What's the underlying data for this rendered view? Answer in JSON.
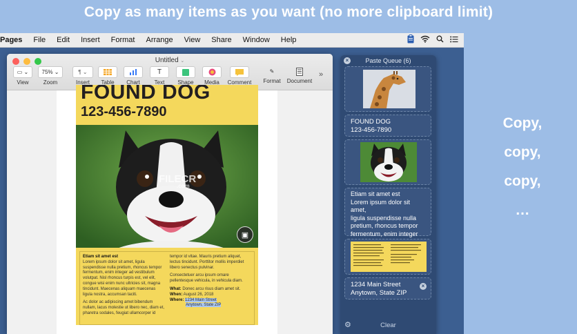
{
  "headline": "Copy as many items as you want (no more clipboard limit)",
  "menubar": {
    "app": "Pages",
    "items": [
      "File",
      "Edit",
      "Insert",
      "Format",
      "Arrange",
      "View",
      "Share",
      "Window",
      "Help"
    ],
    "status_icons": [
      "clipboard-icon",
      "wifi-icon",
      "search-icon",
      "list-icon"
    ]
  },
  "window": {
    "title": "Untitled",
    "zoom_value": "75%",
    "toolbar": [
      {
        "label": "View",
        "icon": "view-icon"
      },
      {
        "label": "Zoom",
        "icon": "zoom-select"
      },
      {
        "label": "Insert",
        "icon": "paragraph-icon"
      },
      {
        "label": "Table",
        "icon": "table-icon"
      },
      {
        "label": "Chart",
        "icon": "chart-icon"
      },
      {
        "label": "Text",
        "icon": "text-icon"
      },
      {
        "label": "Shape",
        "icon": "shape-icon"
      },
      {
        "label": "Media",
        "icon": "media-icon"
      },
      {
        "label": "Comment",
        "icon": "comment-icon"
      },
      {
        "label": "Format",
        "icon": "format-icon"
      },
      {
        "label": "Document",
        "icon": "document-icon"
      }
    ],
    "overflow": "»"
  },
  "flyer": {
    "title": "FOUND DOG",
    "phone": "123-456-7890",
    "col1_heading": "Etiam sit amet est",
    "col1_para1": "Lorem ipsum dolor sit amet, ligula suspendisse nulla pretium, rhoncus tempor fermentum, enim integer ad vestibulum volutpat. Nisl rhoncus turpis est, vel elit, congue wisi enim nunc ultricies sit, magna tincidunt. Maecenas aliquam maecenas ligula nostra, accumsan taciti.",
    "col1_para2": "Ac dolor ac adipiscing amet bibendum nullam, lacus molestie ut libero nec, diam et, pharetra sodales, feugiat ullamcorper id",
    "col2_para1": "tempor id vitae. Mauris pretium aliquet, lectus tincidunt. Porttitor mollis imperdiet libero senectus pulvinar.",
    "col2_para2": "Consectetuer arcu ipsum ornare pellentesque vehicula, in vehicula diam.",
    "what_label": "What:",
    "what_value": "Donec arcu risus diam amet sit.",
    "when_label": "When:",
    "when_value": "August 26, 2018",
    "where_label": "Where:",
    "where_line1": "1234 Main Street",
    "where_line2": "Anytown, State ZIP"
  },
  "watermark": {
    "main": "FILECR",
    "sub": ".com"
  },
  "paste_queue": {
    "title": "Paste Queue (6)",
    "items": [
      {
        "type": "image",
        "name": "giraffe-image"
      },
      {
        "type": "text",
        "line1": "FOUND DOG",
        "line2": "123-456-7890"
      },
      {
        "type": "image",
        "name": "dog-image"
      },
      {
        "type": "text",
        "lines": [
          "Etiam sit amet est",
          "Lorem ipsum dolor sit amet,",
          "ligula suspendisse nulla",
          "pretium, rhoncus tempor",
          "fermentum, enim integer a..."
        ]
      },
      {
        "type": "image",
        "name": "flyer-thumbnail"
      },
      {
        "type": "text",
        "line1": "1234 Main Street",
        "line2": "Anytown, State ZIP"
      }
    ],
    "clear_label": "Clear"
  },
  "side_text": [
    "Copy,",
    "copy,",
    "copy,",
    "…"
  ]
}
